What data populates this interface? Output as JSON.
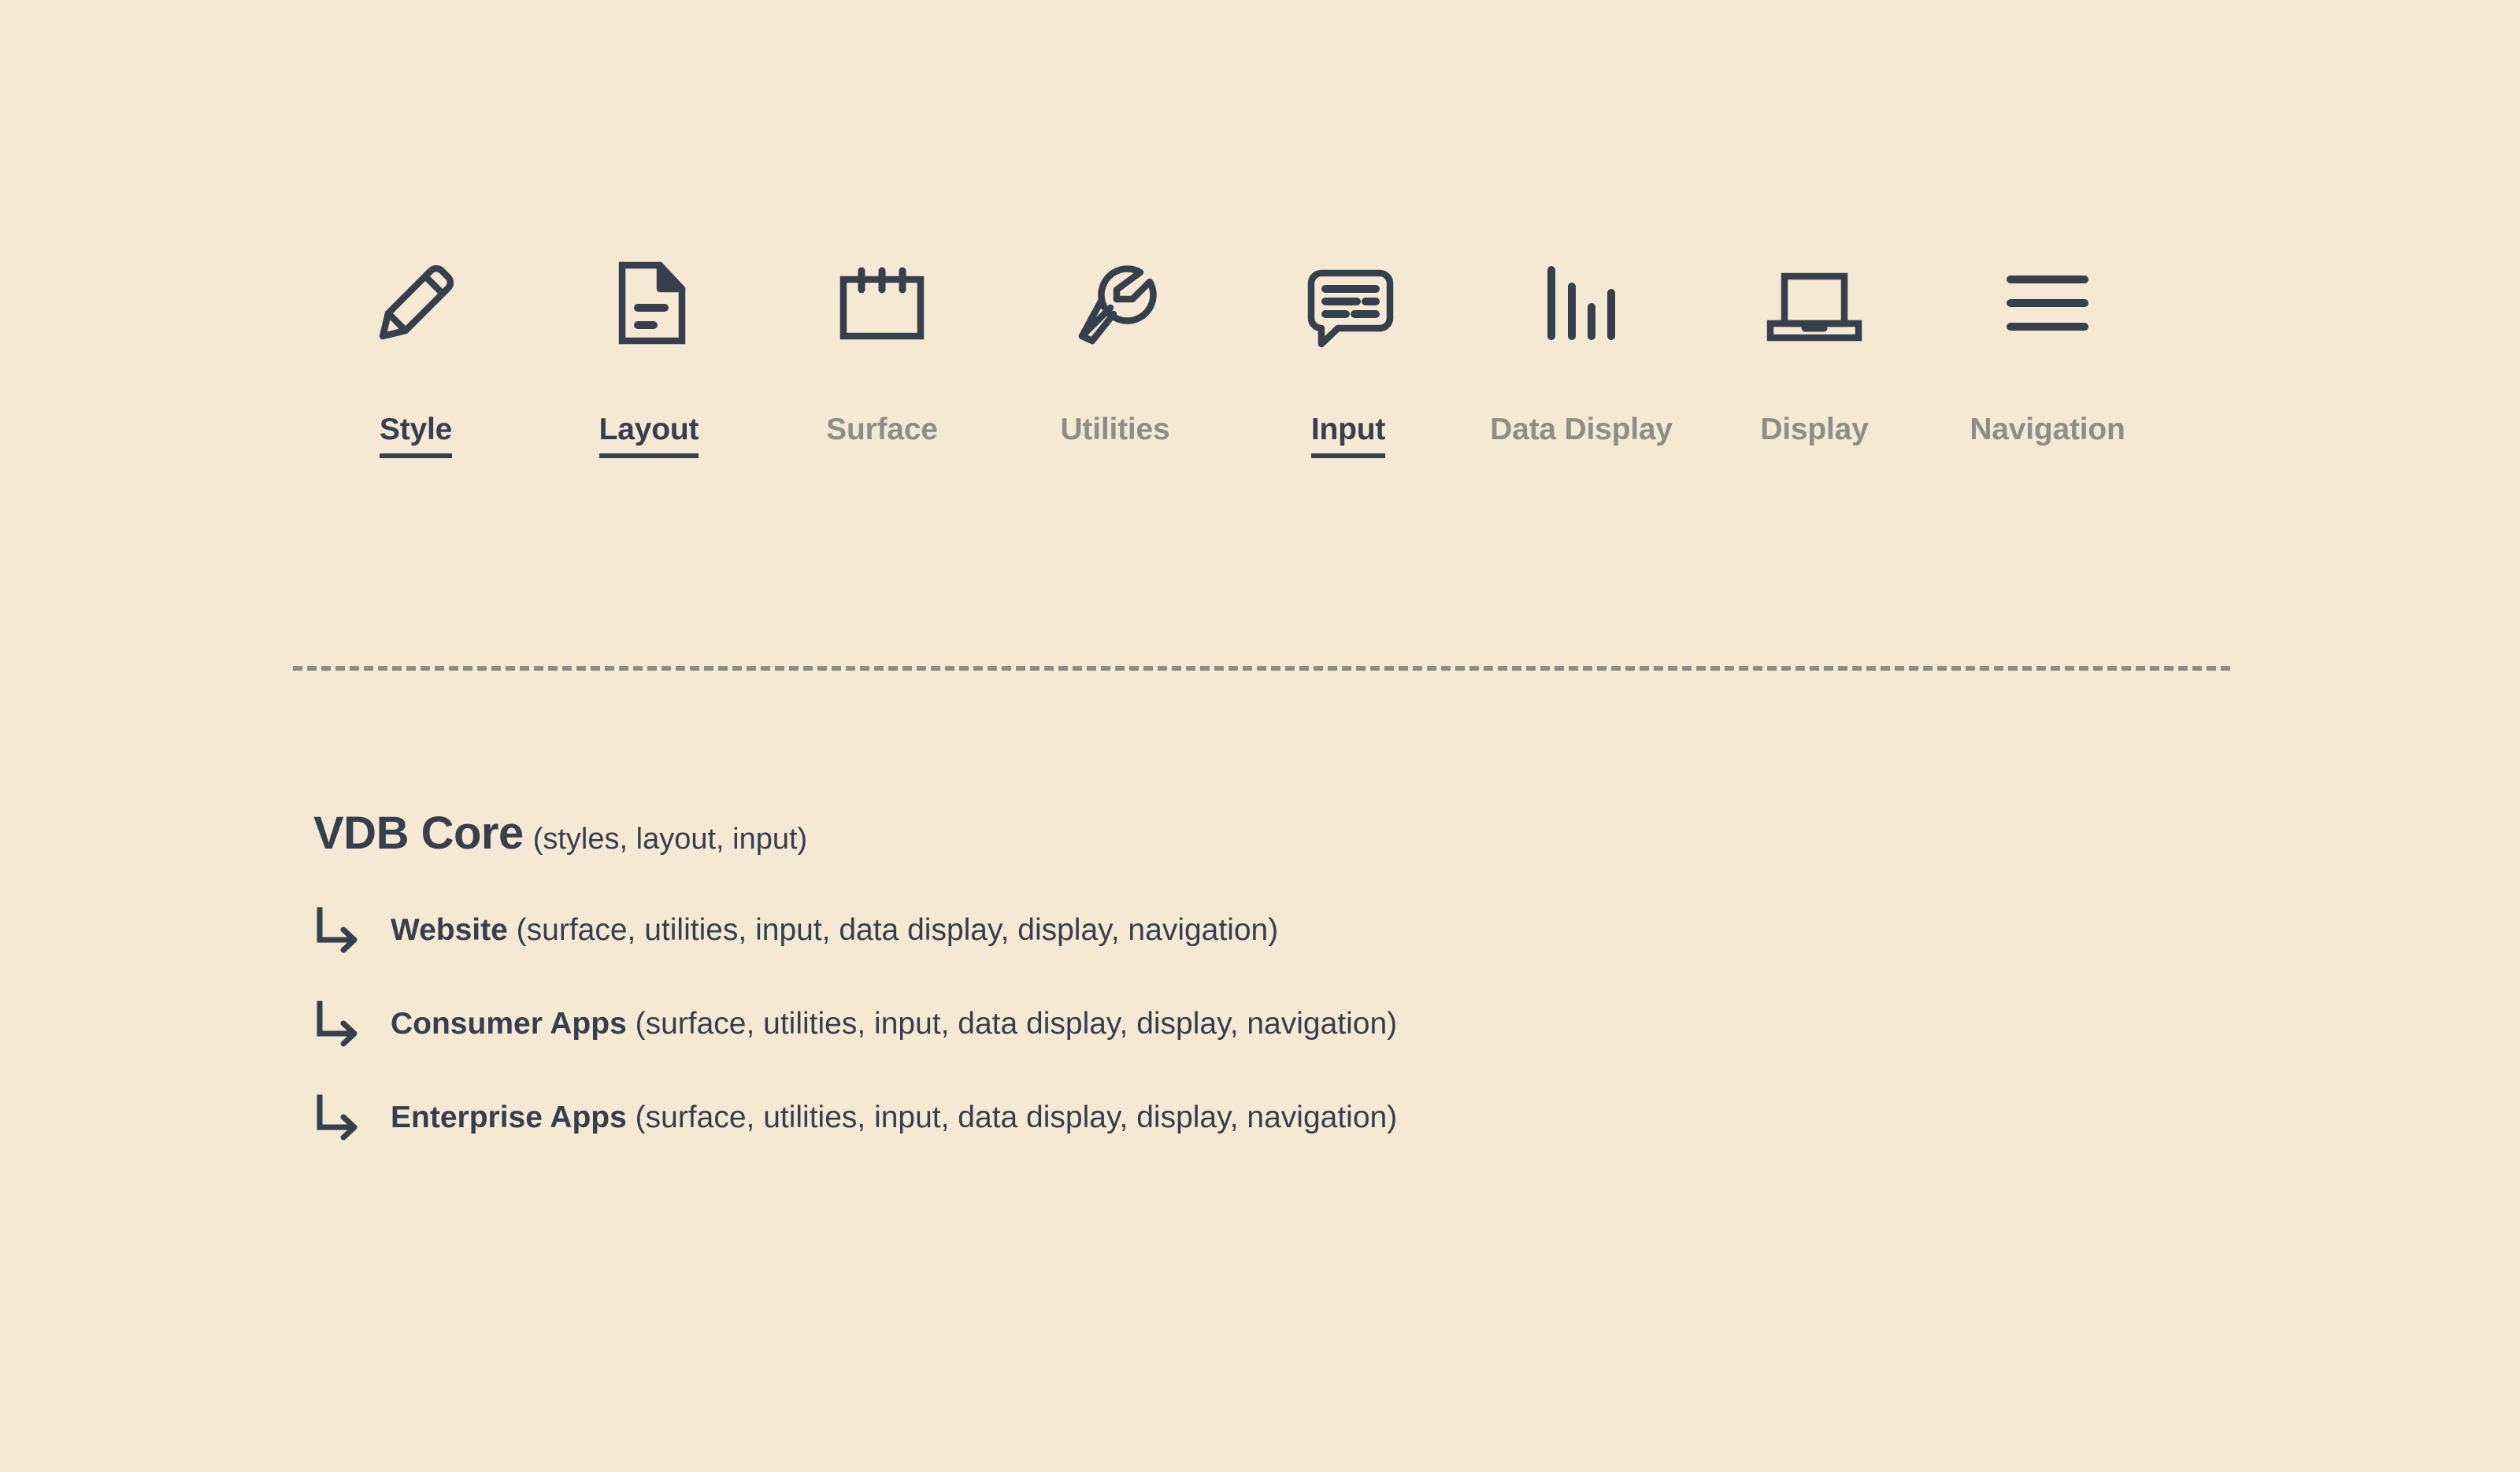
{
  "theme": {
    "background": "#f5e9d4",
    "ink": "#353f4d",
    "muted": "#8e8e88"
  },
  "categories": [
    {
      "label": "Style",
      "icon": "pencil-icon",
      "active": true
    },
    {
      "label": "Layout",
      "icon": "document-icon",
      "active": true
    },
    {
      "label": "Surface",
      "icon": "calendar-card-icon",
      "active": false
    },
    {
      "label": "Utilities",
      "icon": "wrench-icon",
      "active": false
    },
    {
      "label": "Input",
      "icon": "speech-bubble-icon",
      "active": true
    },
    {
      "label": "Data Display",
      "icon": "bar-chart-icon",
      "active": false
    },
    {
      "label": "Display",
      "icon": "laptop-icon",
      "active": false
    },
    {
      "label": "Navigation",
      "icon": "hamburger-menu-icon",
      "active": false
    }
  ],
  "hierarchy": {
    "title_name": "VDB Core",
    "title_paren": "(styles, layout, input)",
    "branch_icon": "branch-arrow-icon",
    "rows": [
      {
        "name": "Website",
        "paren": "(surface, utilities, input, data display, display, navigation)"
      },
      {
        "name": "Consumer Apps",
        "paren": "(surface, utilities, input, data display, display, navigation)"
      },
      {
        "name": "Enterprise Apps",
        "paren": "(surface, utilities, input, data display, display, navigation)"
      }
    ]
  }
}
